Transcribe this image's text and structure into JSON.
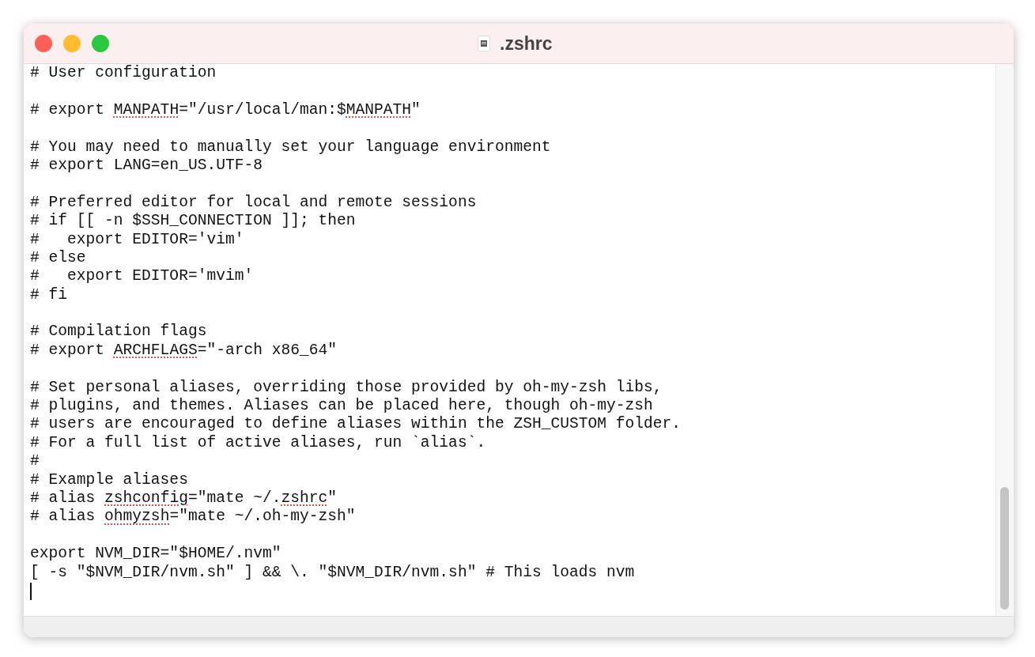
{
  "window": {
    "title": ".zshrc"
  },
  "editor": {
    "lines": [
      {
        "kind": "text",
        "parts": [
          {
            "text": "# User configuration",
            "misspelled": false
          }
        ]
      },
      {
        "kind": "blank"
      },
      {
        "kind": "text",
        "parts": [
          {
            "text": "# export ",
            "misspelled": false
          },
          {
            "text": "MANPATH",
            "misspelled": true
          },
          {
            "text": "=\"/usr/local/man:$",
            "misspelled": false
          },
          {
            "text": "MANPATH",
            "misspelled": true
          },
          {
            "text": "\"",
            "misspelled": false
          }
        ]
      },
      {
        "kind": "blank"
      },
      {
        "kind": "text",
        "parts": [
          {
            "text": "# You may need to manually set your language environment",
            "misspelled": false
          }
        ]
      },
      {
        "kind": "text",
        "parts": [
          {
            "text": "# export LANG=en_US.UTF-8",
            "misspelled": false
          }
        ]
      },
      {
        "kind": "blank"
      },
      {
        "kind": "text",
        "parts": [
          {
            "text": "# Preferred editor for local and remote sessions",
            "misspelled": false
          }
        ]
      },
      {
        "kind": "text",
        "parts": [
          {
            "text": "# if [[ -n $SSH_CONNECTION ]]; then",
            "misspelled": false
          }
        ]
      },
      {
        "kind": "text",
        "parts": [
          {
            "text": "#   export EDITOR='vim'",
            "misspelled": false
          }
        ]
      },
      {
        "kind": "text",
        "parts": [
          {
            "text": "# else",
            "misspelled": false
          }
        ]
      },
      {
        "kind": "text",
        "parts": [
          {
            "text": "#   export EDITOR='mvim'",
            "misspelled": false
          }
        ]
      },
      {
        "kind": "text",
        "parts": [
          {
            "text": "# fi",
            "misspelled": false
          }
        ]
      },
      {
        "kind": "blank"
      },
      {
        "kind": "text",
        "parts": [
          {
            "text": "# Compilation flags",
            "misspelled": false
          }
        ]
      },
      {
        "kind": "text",
        "parts": [
          {
            "text": "# export ",
            "misspelled": false
          },
          {
            "text": "ARCHFLAGS",
            "misspelled": true
          },
          {
            "text": "=\"-arch x86_64\"",
            "misspelled": false
          }
        ]
      },
      {
        "kind": "blank"
      },
      {
        "kind": "text",
        "parts": [
          {
            "text": "# Set personal aliases, overriding those provided by oh-my-zsh libs,",
            "misspelled": false
          }
        ]
      },
      {
        "kind": "text",
        "parts": [
          {
            "text": "# plugins, and themes. Aliases can be placed here, though oh-my-zsh",
            "misspelled": false
          }
        ]
      },
      {
        "kind": "text",
        "parts": [
          {
            "text": "# users are encouraged to define aliases within the ZSH_CUSTOM folder.",
            "misspelled": false
          }
        ]
      },
      {
        "kind": "text",
        "parts": [
          {
            "text": "# For a full list of active aliases, run `alias`.",
            "misspelled": false
          }
        ]
      },
      {
        "kind": "text",
        "parts": [
          {
            "text": "#",
            "misspelled": false
          }
        ]
      },
      {
        "kind": "text",
        "parts": [
          {
            "text": "# Example aliases",
            "misspelled": false
          }
        ]
      },
      {
        "kind": "text",
        "parts": [
          {
            "text": "# alias ",
            "misspelled": false
          },
          {
            "text": "zshconfig",
            "misspelled": true
          },
          {
            "text": "=\"mate ~/.",
            "misspelled": false
          },
          {
            "text": "zshrc",
            "misspelled": true
          },
          {
            "text": "\"",
            "misspelled": false
          }
        ]
      },
      {
        "kind": "text",
        "parts": [
          {
            "text": "# alias ",
            "misspelled": false
          },
          {
            "text": "ohmyzsh",
            "misspelled": true
          },
          {
            "text": "=\"mate ~/.oh-my-zsh\"",
            "misspelled": false
          }
        ]
      },
      {
        "kind": "blank"
      },
      {
        "kind": "text",
        "parts": [
          {
            "text": "export NVM_DIR=\"$HOME/.nvm\"",
            "misspelled": false
          }
        ]
      },
      {
        "kind": "text",
        "parts": [
          {
            "text": "[ -s \"$NVM_DIR/nvm.sh\" ] && \\. \"$NVM_DIR/nvm.sh\" # This loads nvm",
            "misspelled": false
          }
        ]
      },
      {
        "kind": "caret"
      }
    ]
  }
}
